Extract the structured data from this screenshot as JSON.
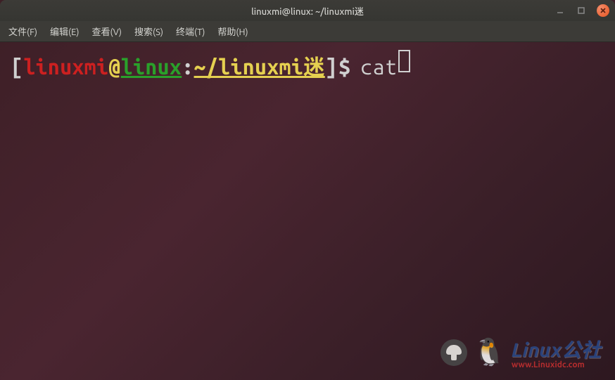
{
  "window": {
    "title": "linuxmi@linux: ~/linuxmi迷"
  },
  "menubar": {
    "items": [
      {
        "label": "文件(F)"
      },
      {
        "label": "编辑(E)"
      },
      {
        "label": "查看(V)"
      },
      {
        "label": "搜索(S)"
      },
      {
        "label": "终端(T)"
      },
      {
        "label": "帮助(H)"
      }
    ]
  },
  "prompt": {
    "open_bracket": "[",
    "user": "linuxmi",
    "at": "@",
    "host": "linux",
    "colon": ":",
    "path": "~/linuxmi迷",
    "close_bracket": "]",
    "symbol": "$",
    "command": "cat"
  },
  "watermark": {
    "main": "Linux公社",
    "sub": "www.Linuxidc.com"
  }
}
